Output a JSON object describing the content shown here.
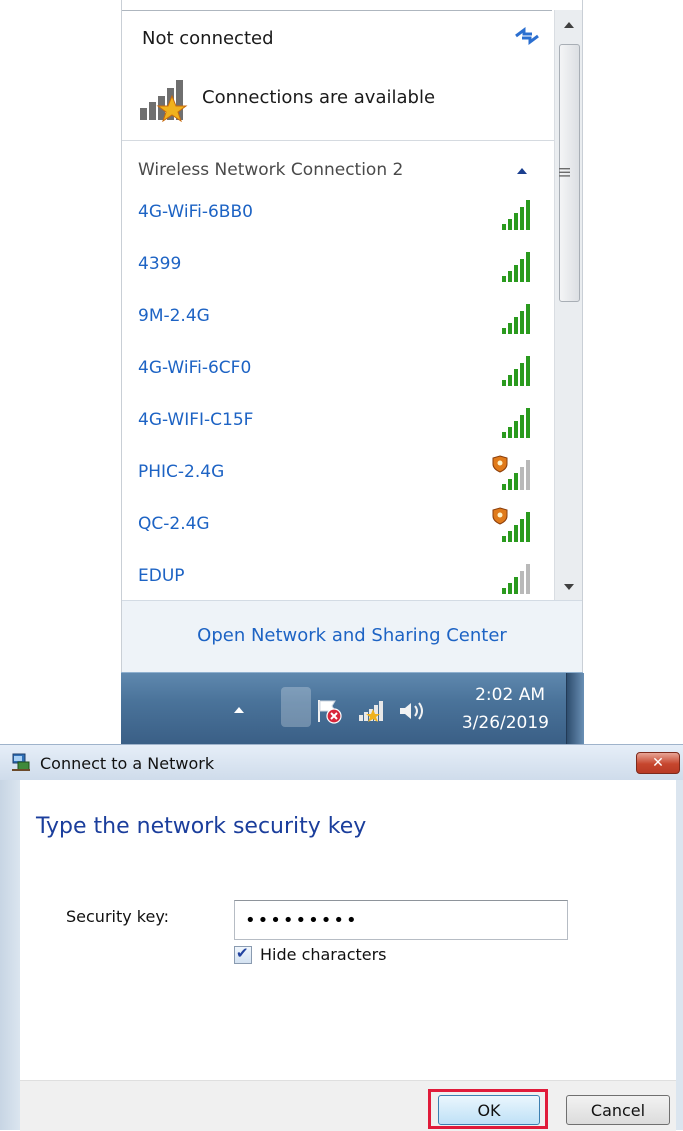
{
  "flyout": {
    "status": "Not connected",
    "availability": "Connections are available",
    "adapter": "Wireless Network Connection 2",
    "networks": [
      {
        "name": "4G-WiFi-6BB0",
        "signal_bars": 5,
        "secured_warning": false
      },
      {
        "name": "4399",
        "signal_bars": 5,
        "secured_warning": false
      },
      {
        "name": "9M-2.4G",
        "signal_bars": 5,
        "secured_warning": false
      },
      {
        "name": "4G-WiFi-6CF0",
        "signal_bars": 5,
        "secured_warning": false
      },
      {
        "name": "4G-WIFI-C15F",
        "signal_bars": 5,
        "secured_warning": false
      },
      {
        "name": "PHIC-2.4G",
        "signal_bars": 3,
        "secured_warning": true
      },
      {
        "name": "QC-2.4G",
        "signal_bars": 5,
        "secured_warning": true
      },
      {
        "name": "EDUP",
        "signal_bars": 3,
        "secured_warning": false
      }
    ],
    "open_center_link": "Open Network and Sharing Center",
    "icons": {
      "refresh": "refresh-icon",
      "collapse": "chevron-up-icon",
      "availability": "signal-warning-icon"
    }
  },
  "taskbar": {
    "time": "2:02 AM",
    "date": "3/26/2019",
    "icons": [
      "show-hidden-icons-arrow",
      "action-center-flag-icon",
      "network-icon",
      "volume-icon"
    ]
  },
  "dialog": {
    "title": "Connect to a Network",
    "heading": "Type the network security key",
    "key_label": "Security key:",
    "key_value": "•••••••••",
    "hide_characters_label": "Hide characters",
    "hide_characters_checked": true,
    "ok_label": "OK",
    "cancel_label": "Cancel",
    "close_label": "✕"
  },
  "colors": {
    "link_blue": "#1d63c4",
    "heading_blue": "#1b3e9c",
    "signal_green": "#2a9a1e",
    "highlight_red": "#e01b3a",
    "taskbar_blue": "#4a739a"
  }
}
